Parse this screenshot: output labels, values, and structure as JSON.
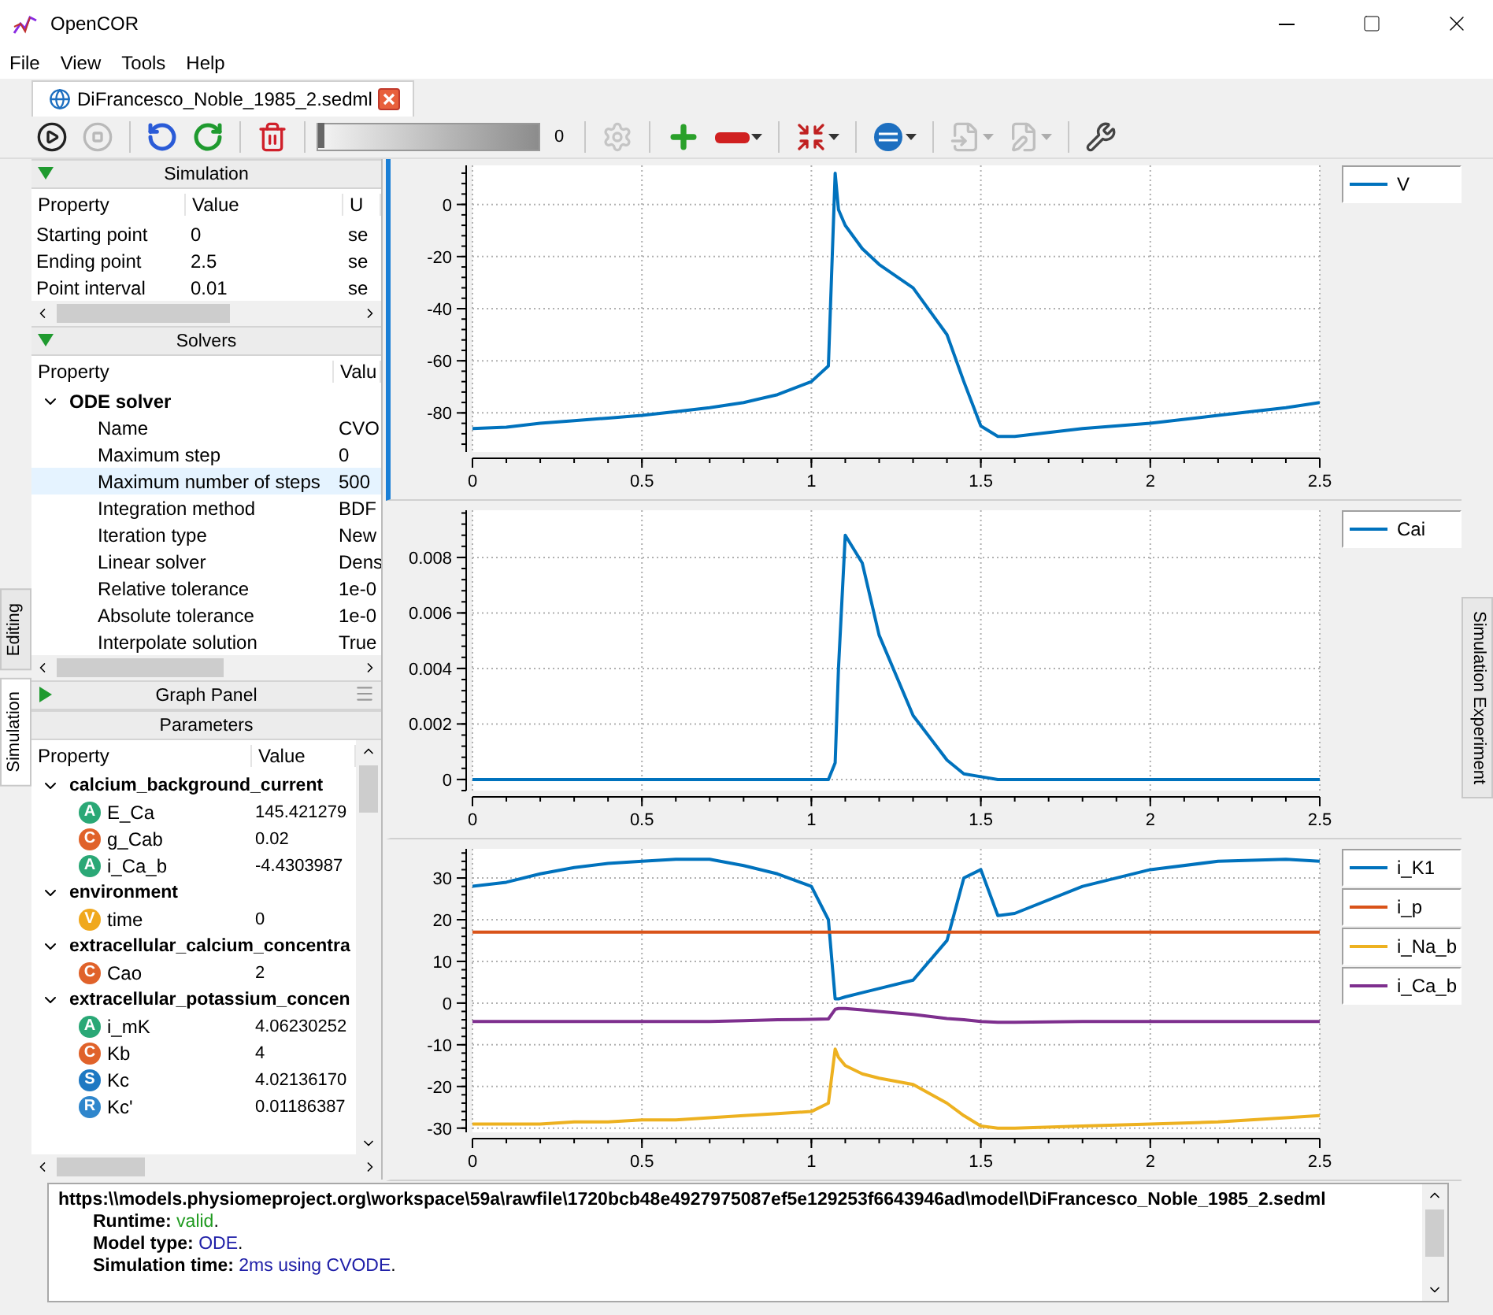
{
  "window": {
    "title": "OpenCOR"
  },
  "menu": [
    "File",
    "View",
    "Tools",
    "Help"
  ],
  "tabs": [
    {
      "label": "DiFrancesco_Noble_1985_2.sedml",
      "selected": true
    }
  ],
  "toolbar": [
    {
      "kind": "run",
      "disabled": false,
      "dropdown": false
    },
    {
      "kind": "stop",
      "disabled": true,
      "dropdown": false
    },
    {
      "kind": "separator"
    },
    {
      "kind": "reset",
      "disabled": false,
      "dropdown": false
    },
    {
      "kind": "rerun",
      "disabled": false,
      "dropdown": false
    },
    {
      "kind": "separator"
    },
    {
      "kind": "delete",
      "disabled": false,
      "dropdown": false
    },
    {
      "kind": "separator"
    },
    {
      "kind": "delay",
      "level": 0,
      "reading": "0"
    },
    {
      "kind": "separator"
    },
    {
      "kind": "settings",
      "disabled": true,
      "dropdown": false
    },
    {
      "kind": "separator"
    },
    {
      "kind": "add",
      "disabled": false,
      "dropdown": false
    },
    {
      "kind": "remove",
      "disabled": false,
      "dropdown": true
    },
    {
      "kind": "separator"
    },
    {
      "kind": "arrows",
      "disabled": false,
      "dropdown": true
    },
    {
      "kind": "separator"
    },
    {
      "kind": "sedml",
      "disabled": false,
      "dropdown": true
    },
    {
      "kind": "separator"
    },
    {
      "kind": "import",
      "disabled": true,
      "dropdown": true
    },
    {
      "kind": "export",
      "disabled": true,
      "dropdown": true
    },
    {
      "kind": "separator"
    },
    {
      "kind": "tools",
      "disabled": false,
      "dropdown": false
    }
  ],
  "side_tabs": [
    {
      "label": "Editing",
      "selected": false
    },
    {
      "label": "Simulation",
      "selected": true
    }
  ],
  "right_tabs": [
    {
      "label": "Simulation Experiment",
      "selected": false
    }
  ],
  "simulation": {
    "title": "Simulation",
    "expanded": true,
    "columns": [
      "Property",
      "Value",
      "U"
    ],
    "rows": [
      {
        "name": "Starting point",
        "value": "0",
        "unit": "se"
      },
      {
        "name": "Ending point",
        "value": "2.5",
        "unit": "se"
      },
      {
        "name": "Point interval",
        "value": "0.01",
        "unit": "se"
      }
    ]
  },
  "solvers": {
    "title": "Solvers",
    "expanded": true,
    "columns": [
      "Property",
      "Valu"
    ],
    "groups": [
      {
        "name": "ODE solver",
        "expanded": true,
        "children": [
          {
            "name": "Name",
            "value": "CVO",
            "selected": false
          },
          {
            "name": "Maximum step",
            "value": "0",
            "selected": false
          },
          {
            "name": "Maximum number of steps",
            "value": "500",
            "selected": true
          },
          {
            "name": "Integration method",
            "value": "BDF",
            "selected": false
          },
          {
            "name": "Iteration type",
            "value": "New",
            "selected": false
          },
          {
            "name": "Linear solver",
            "value": "Dens",
            "selected": false
          },
          {
            "name": "Relative tolerance",
            "value": "1e-0",
            "selected": false
          },
          {
            "name": "Absolute tolerance",
            "value": "1e-0",
            "selected": false
          },
          {
            "name": "Interpolate solution",
            "value": "True",
            "selected": false
          }
        ]
      }
    ]
  },
  "graph_panel": {
    "title": "Graph Panel",
    "expanded": false
  },
  "parameters": {
    "title": "Parameters",
    "columns": [
      "Property",
      "Value"
    ],
    "groups": [
      {
        "name": "calcium_background_current",
        "expanded": true,
        "children": [
          {
            "badge": "A",
            "color": "#2aa876",
            "name": "E_Ca",
            "value": "145.421279"
          },
          {
            "badge": "C",
            "color": "#e0622a",
            "name": "g_Cab",
            "value": "0.02"
          },
          {
            "badge": "A",
            "color": "#2aa876",
            "name": "i_Ca_b",
            "value": "-4.4303987"
          }
        ]
      },
      {
        "name": "environment",
        "expanded": true,
        "children": [
          {
            "badge": "V",
            "color": "#f0a81c",
            "name": "time",
            "value": "0"
          }
        ]
      },
      {
        "name": "extracellular_calcium_concentra",
        "expanded": true,
        "children": [
          {
            "badge": "C",
            "color": "#e0622a",
            "name": "Cao",
            "value": "2"
          }
        ]
      },
      {
        "name": "extracellular_potassium_concen",
        "expanded": true,
        "children": [
          {
            "badge": "A",
            "color": "#2aa876",
            "name": "i_mK",
            "value": "4.06230252"
          },
          {
            "badge": "C",
            "color": "#e0622a",
            "name": "Kb",
            "value": "4"
          },
          {
            "badge": "S",
            "color": "#1e78c2",
            "name": "Kc",
            "value": "4.02136170"
          },
          {
            "badge": "R",
            "color": "#2f86cc",
            "name": "Kc'",
            "value": "0.01186387"
          }
        ]
      }
    ]
  },
  "graphs": [
    {
      "selected": true,
      "chart_data": {
        "type": "line",
        "x": [
          0,
          0.1,
          0.2,
          0.3,
          0.4,
          0.5,
          0.6,
          0.7,
          0.8,
          0.9,
          1.0,
          1.05,
          1.07,
          1.08,
          1.1,
          1.15,
          1.2,
          1.3,
          1.4,
          1.45,
          1.5,
          1.55,
          1.6,
          1.8,
          2.0,
          2.2,
          2.4,
          2.5
        ],
        "series": [
          {
            "name": "V",
            "color": "#0072bd",
            "values": [
              -86,
              -85.5,
              -84,
              -83,
              -82,
              -81,
              -79.5,
              -78,
              -76,
              -73,
              -68,
              -62,
              12,
              -2,
              -8,
              -17,
              -23,
              -32,
              -50,
              -68,
              -85,
              -89,
              -89,
              -86,
              -84,
              -81,
              -78,
              -76
            ]
          }
        ],
        "grid": true,
        "xlim": [
          0,
          2.5
        ],
        "ylim": [
          -95,
          15
        ],
        "xticks": [
          0,
          0.5,
          1,
          1.5,
          2,
          2.5
        ],
        "yticks": [
          -80,
          -60,
          -40,
          -20,
          0
        ]
      }
    },
    {
      "selected": false,
      "chart_data": {
        "type": "line",
        "x": [
          0,
          0.1,
          0.2,
          0.3,
          0.4,
          0.5,
          0.6,
          0.7,
          0.8,
          0.9,
          1.0,
          1.05,
          1.07,
          1.08,
          1.1,
          1.15,
          1.2,
          1.3,
          1.4,
          1.45,
          1.5,
          1.55,
          1.6,
          1.8,
          2.0,
          2.2,
          2.4,
          2.5
        ],
        "series": [
          {
            "name": "Cai",
            "color": "#0072bd",
            "values": [
              0,
              0,
              0,
              0,
              0,
              0,
              0,
              0,
              0,
              0,
              0,
              0,
              0.0006,
              0.004,
              0.0088,
              0.0078,
              0.0052,
              0.0023,
              0.0007,
              0.0002,
              0.0001,
              0,
              0,
              0,
              0,
              0,
              0,
              0
            ]
          }
        ],
        "grid": true,
        "xlim": [
          0,
          2.5
        ],
        "ylim": [
          -0.0004,
          0.0097
        ],
        "xticks": [
          0,
          0.5,
          1,
          1.5,
          2,
          2.5
        ],
        "yticks": [
          0,
          0.002,
          0.004,
          0.006,
          0.008
        ]
      }
    },
    {
      "selected": false,
      "chart_data": {
        "type": "line",
        "x": [
          0,
          0.1,
          0.2,
          0.3,
          0.4,
          0.5,
          0.6,
          0.7,
          0.8,
          0.9,
          1.0,
          1.05,
          1.07,
          1.08,
          1.1,
          1.15,
          1.2,
          1.3,
          1.4,
          1.45,
          1.5,
          1.55,
          1.6,
          1.8,
          2.0,
          2.2,
          2.4,
          2.5
        ],
        "series": [
          {
            "name": "i_K1",
            "color": "#0072bd",
            "values": [
              28,
              29,
              31,
              32.5,
              33.5,
              34,
              34.5,
              34.5,
              33,
              31,
              28,
              20,
              1,
              1,
              1.5,
              2.5,
              3.5,
              5.5,
              15,
              30,
              32,
              21,
              21.5,
              28,
              32,
              34,
              34.5,
              34
            ]
          },
          {
            "name": "i_p",
            "color": "#d95319",
            "values": [
              17,
              17,
              17,
              17,
              17,
              17,
              17,
              17,
              17,
              17,
              17,
              17,
              17,
              17,
              17,
              17,
              17,
              17,
              17,
              17,
              17,
              17,
              17,
              17,
              17,
              17,
              17,
              17
            ]
          },
          {
            "name": "i_Na_b",
            "color": "#edb120",
            "values": [
              -29,
              -29,
              -29,
              -28.5,
              -28.5,
              -28,
              -28,
              -27.5,
              -27,
              -26.5,
              -26,
              -24,
              -11,
              -13,
              -15,
              -17,
              -18,
              -19.5,
              -24,
              -27,
              -29.5,
              -30,
              -30,
              -29.5,
              -29,
              -28.5,
              -27.5,
              -27
            ]
          },
          {
            "name": "i_Ca_b",
            "color": "#7e2f8e",
            "values": [
              -4.4,
              -4.4,
              -4.4,
              -4.4,
              -4.4,
              -4.4,
              -4.4,
              -4.4,
              -4.2,
              -4,
              -3.9,
              -3.8,
              -1.5,
              -1.3,
              -1.3,
              -1.6,
              -2,
              -2.7,
              -3.7,
              -4,
              -4.4,
              -4.6,
              -4.6,
              -4.4,
              -4.4,
              -4.4,
              -4.4,
              -4.4
            ]
          }
        ],
        "grid": true,
        "xlim": [
          0,
          2.5
        ],
        "ylim": [
          -31,
          37
        ],
        "xticks": [
          0,
          0.5,
          1,
          1.5,
          2,
          2.5
        ],
        "yticks": [
          -30,
          -20,
          -10,
          0,
          10,
          20,
          30
        ]
      }
    }
  ],
  "output": {
    "url": "https:\\\\models.physiomeproject.org\\workspace\\59a\\rawfile\\1720bcb48e4927975087ef5e129253f6643946ad\\model\\DiFrancesco_Noble_1985_2.sedml",
    "lines": [
      {
        "label": "Runtime:",
        "value": "valid",
        "suffix": ".",
        "color": "#1f9a1f"
      },
      {
        "label": "Model type:",
        "value": "ODE",
        "suffix": ".",
        "color": "#2020a8"
      },
      {
        "label": "Simulation time:",
        "value": "2ms using CVODE",
        "suffix": ".",
        "color": "#2020a8"
      }
    ]
  }
}
